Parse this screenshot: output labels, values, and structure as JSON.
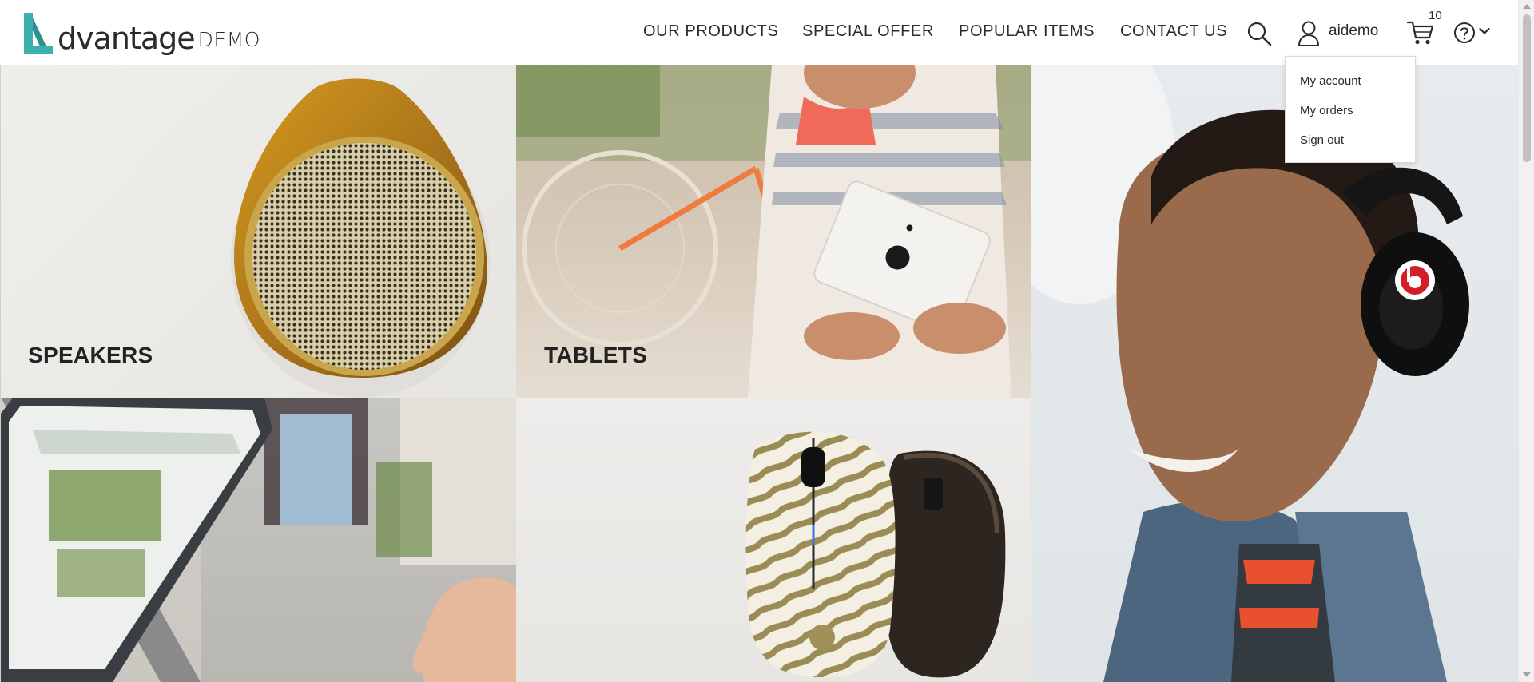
{
  "logo": {
    "brand_word": "dvantage",
    "brand_suffix": "DEMO"
  },
  "nav": {
    "items": [
      {
        "label": "OUR PRODUCTS"
      },
      {
        "label": "SPECIAL OFFER"
      },
      {
        "label": "POPULAR ITEMS"
      },
      {
        "label": "CONTACT US"
      }
    ]
  },
  "header": {
    "username": "aidemo",
    "cart_count": "10",
    "icons": [
      "search-icon",
      "user-icon",
      "cart-icon",
      "help-icon",
      "chevron-down-icon"
    ]
  },
  "user_menu": {
    "items": [
      {
        "label": "My account"
      },
      {
        "label": "My orders"
      },
      {
        "label": "Sign out"
      }
    ]
  },
  "categories": {
    "speakers": {
      "label": "SPEAKERS"
    },
    "tablets": {
      "label": "TABLETS"
    },
    "headphones": {
      "label": ""
    },
    "laptops": {
      "label": ""
    },
    "mice": {
      "label": ""
    }
  },
  "colors": {
    "brand_accent": "#3bb0ad",
    "text": "#2b2b2b",
    "tile_bg_light": "#ecebe8",
    "speaker_gold": "#b8860b"
  }
}
